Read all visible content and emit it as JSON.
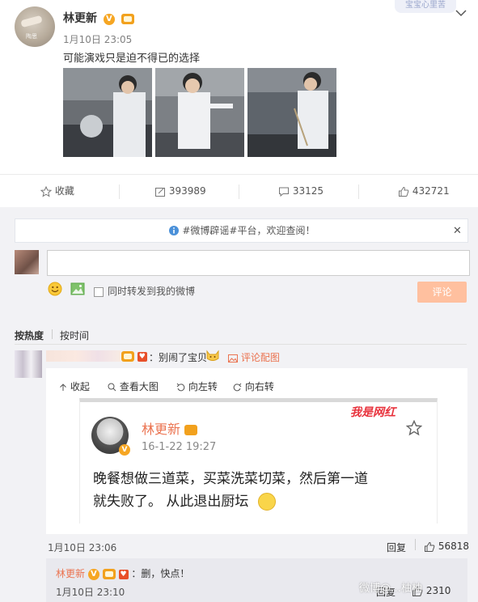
{
  "post": {
    "user_name": "林更新",
    "avatar_watermark": "陶思",
    "time": "1月10日 23:05",
    "text": "可能演戏只是迫不得已的选择",
    "top_right_watermark": "宝宝心里苦"
  },
  "actions": {
    "favorite": "收藏",
    "repost": "393989",
    "comment": "33125",
    "like": "432721"
  },
  "notice": {
    "text": "#微博辟谣#平台，欢迎查阅！"
  },
  "composer": {
    "input_value": "",
    "sync_label": "同时转发到我的微博",
    "submit_label": "评论"
  },
  "sort": {
    "hot": "按热度",
    "time": "按时间"
  },
  "comment": {
    "text": "：别闹了宝贝",
    "image_link": "评论配图",
    "toolbar": {
      "collapse": "收起",
      "view_large": "查看大图",
      "rotate_left": "向左转",
      "rotate_right": "向右转"
    },
    "inner": {
      "watermark": "我是网红",
      "name": "林更新",
      "date": "16-1-22 19:27",
      "text_line1": "晚餐想做三道菜，买菜洗菜切菜，然后第一道",
      "text_line2": "就失败了。 从此退出厨坛"
    },
    "time": "1月10日 23:06",
    "reply_label": "回复",
    "likes": "56818"
  },
  "sub_reply": {
    "name": "林更新",
    "text": "：删，快点！",
    "time": "1月10日 23:10",
    "reply_label": "回复",
    "likes": "2310",
    "corner_watermark": "微博@…柚柚"
  },
  "colors": {
    "accent": "#eb7350",
    "background": "#f2f2f5",
    "submit_disabled": "#ffc09f",
    "verified": "#f6a623",
    "info_icon": "#4a90d9"
  }
}
